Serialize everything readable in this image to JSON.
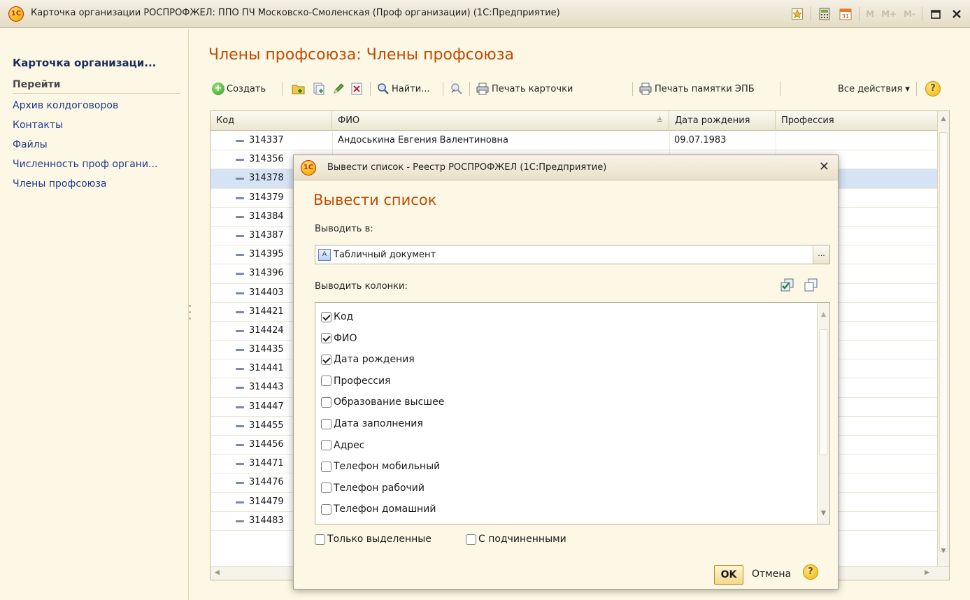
{
  "window": {
    "title": "Карточка организации РОСПРОФЖЕЛ: ППО ПЧ Московско-Смоленская (Проф организации) (1С:Предприятие)",
    "logo": "1С",
    "icons": [
      "star-icon",
      "calculator-icon",
      "calendar-icon",
      "memory-m-icon",
      "restore-icon",
      "close-icon"
    ],
    "m_labels": [
      "M",
      "M+",
      "M-"
    ]
  },
  "sidebar": {
    "org_title": "Карточка организаци...",
    "section": "Перейти",
    "items": [
      {
        "label": "Архив колдоговоров"
      },
      {
        "label": "Контакты"
      },
      {
        "label": "Файлы"
      },
      {
        "label": "Численность проф органи..."
      },
      {
        "label": "Члены профсоюза"
      }
    ]
  },
  "main": {
    "title": "Члены профсоюза: Члены профсоюза",
    "toolbar": {
      "create": "Создать",
      "find": "Найти...",
      "print_card": "Печать карточки",
      "print_memo": "Печать памятки ЭПБ",
      "all_actions": "Все действия ▾",
      "help": "?"
    },
    "table": {
      "columns": [
        "Код",
        "ФИО",
        "Дата рождения",
        "Профессия"
      ],
      "rows": [
        {
          "code": "314337",
          "fio": "Андоськина Евгения Валентиновна",
          "dob": "09.07.1983"
        },
        {
          "code": "314356",
          "fio": "",
          "dob": ""
        },
        {
          "code": "314378",
          "fio": "",
          "dob": ""
        },
        {
          "code": "314379",
          "fio": "",
          "dob": ""
        },
        {
          "code": "314384",
          "fio": "",
          "dob": ""
        },
        {
          "code": "314387",
          "fio": "",
          "dob": ""
        },
        {
          "code": "314395",
          "fio": "",
          "dob": ""
        },
        {
          "code": "314396",
          "fio": "",
          "dob": ""
        },
        {
          "code": "314403",
          "fio": "",
          "dob": ""
        },
        {
          "code": "314421",
          "fio": "",
          "dob": ""
        },
        {
          "code": "314424",
          "fio": "",
          "dob": ""
        },
        {
          "code": "314435",
          "fio": "",
          "dob": ""
        },
        {
          "code": "314441",
          "fio": "",
          "dob": ""
        },
        {
          "code": "314443",
          "fio": "",
          "dob": ""
        },
        {
          "code": "314447",
          "fio": "",
          "dob": ""
        },
        {
          "code": "314455",
          "fio": "",
          "dob": ""
        },
        {
          "code": "314456",
          "fio": "",
          "dob": ""
        },
        {
          "code": "314471",
          "fio": "",
          "dob": ""
        },
        {
          "code": "314476",
          "fio": "",
          "dob": ""
        },
        {
          "code": "314479",
          "fio": "",
          "dob": ""
        },
        {
          "code": "314483",
          "fio": "",
          "dob": ""
        }
      ],
      "selected_row": 2
    }
  },
  "dialog": {
    "title": "Вывести список - Реестр РОСПРОФЖЕЛ  (1С:Предприятие)",
    "heading": "Вывести список",
    "output_to_label": "Выводить в:",
    "output_to_value": "Табличный документ",
    "more_label": "...",
    "columns_label": "Выводить колонки:",
    "columns": [
      {
        "label": "Код",
        "checked": true
      },
      {
        "label": "ФИО",
        "checked": true
      },
      {
        "label": "Дата рождения",
        "checked": true
      },
      {
        "label": "Профессия",
        "checked": false
      },
      {
        "label": "Образование высшее",
        "checked": false
      },
      {
        "label": "Дата заполнения",
        "checked": false
      },
      {
        "label": "Адрес",
        "checked": false
      },
      {
        "label": "Телефон мобильный",
        "checked": false
      },
      {
        "label": "Телефон рабочий",
        "checked": false
      },
      {
        "label": "Телефон домашний",
        "checked": false
      }
    ],
    "only_selected": "Только выделенные",
    "with_children": "С подчиненными",
    "ok": "OK",
    "cancel": "Отмена",
    "help": "?"
  },
  "colors": {
    "title_orange": "#c04b00",
    "link_blue": "#1e3a8a",
    "selected_row": "#d5e3f5",
    "background": "#fdf8e6"
  }
}
